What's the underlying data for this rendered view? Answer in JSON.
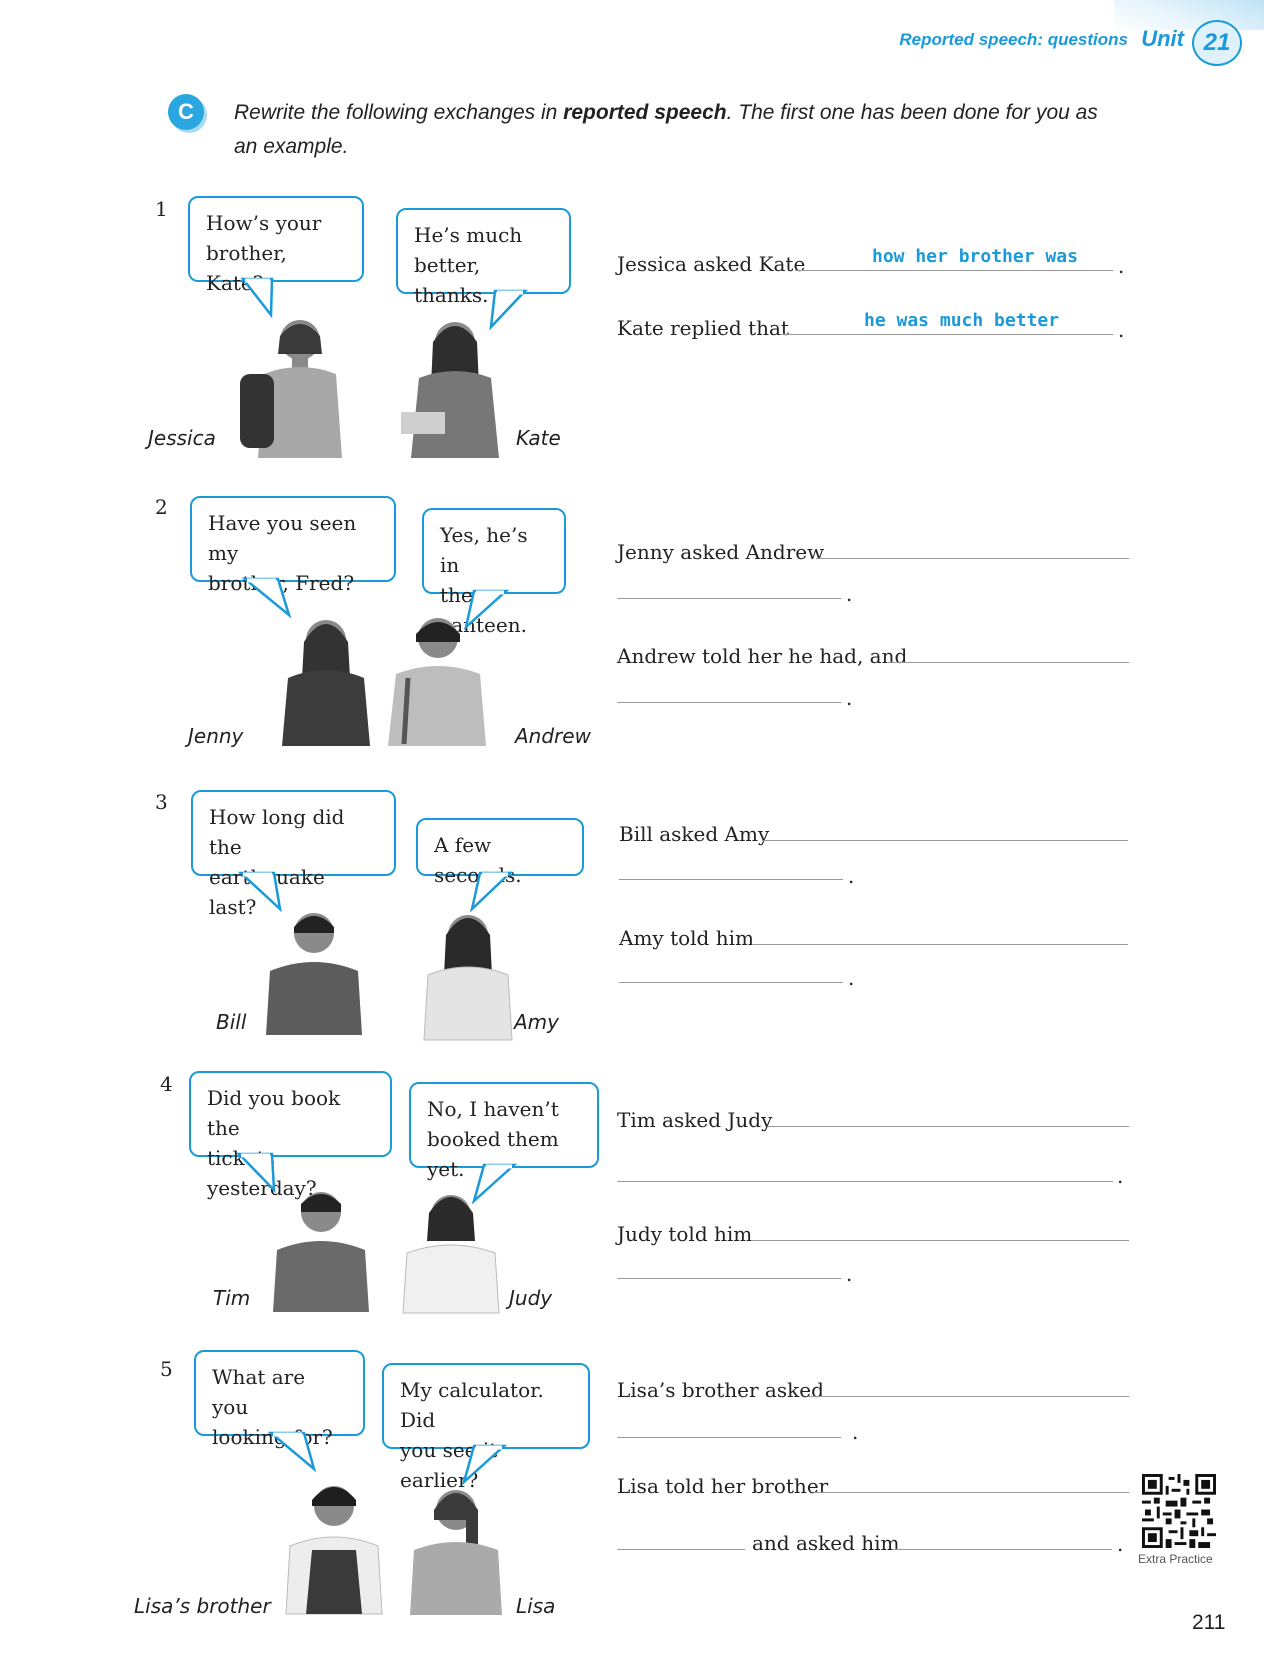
{
  "header": {
    "title": "Reported speech: questions",
    "unit_label": "Unit",
    "unit_number": "21"
  },
  "section": {
    "letter": "C",
    "instr_part1": "Rewrite the following exchanges in ",
    "instr_bold": "reported speech",
    "instr_part2": ". The first one has been done for you as an example."
  },
  "exercises": [
    {
      "number": "1",
      "bubble_left": [
        "How’s your",
        "brother, Kate?"
      ],
      "bubble_right": [
        "He’s much",
        "better, thanks."
      ],
      "name_left": "Jessica",
      "name_right": "Kate",
      "sentence1": "Jessica asked Kate",
      "answer1": "how her brother was",
      "sentence2": "Kate replied that",
      "answer2": "he was much better"
    },
    {
      "number": "2",
      "bubble_left": [
        "Have you seen my",
        "brother, Fred?"
      ],
      "bubble_right": [
        "Yes, he’s in",
        "the canteen."
      ],
      "name_left": "Jenny",
      "name_right": "Andrew",
      "sentence1": "Jenny asked Andrew",
      "sentence2": "Andrew told her he had, and"
    },
    {
      "number": "3",
      "bubble_left": [
        "How long did the",
        "earthquake last?"
      ],
      "bubble_right": [
        "A few seconds."
      ],
      "name_left": "Bill",
      "name_right": "Amy",
      "sentence1": "Bill asked Amy",
      "sentence2": "Amy told him"
    },
    {
      "number": "4",
      "bubble_left": [
        "Did you book the",
        "tickets yesterday?"
      ],
      "bubble_right": [
        "No, I haven’t",
        "booked them yet."
      ],
      "name_left": "Tim",
      "name_right": "Judy",
      "sentence1": "Tim asked Judy",
      "sentence2": "Judy told him"
    },
    {
      "number": "5",
      "bubble_left": [
        "What are you",
        "looking for?"
      ],
      "bubble_right": [
        "My calculator. Did",
        "you see it earlier?"
      ],
      "name_left": "Lisa’s brother",
      "name_right": "Lisa",
      "sentence1": "Lisa’s brother asked",
      "sentence2": "Lisa told her brother",
      "sentence3": "and asked him"
    }
  ],
  "dot": ".",
  "qr_label": "Extra Practice",
  "page_number": "211",
  "colors": {
    "accent": "#1a9ad9",
    "badge": "#2aa6e0",
    "photo_gray": "#8a8a8a"
  }
}
